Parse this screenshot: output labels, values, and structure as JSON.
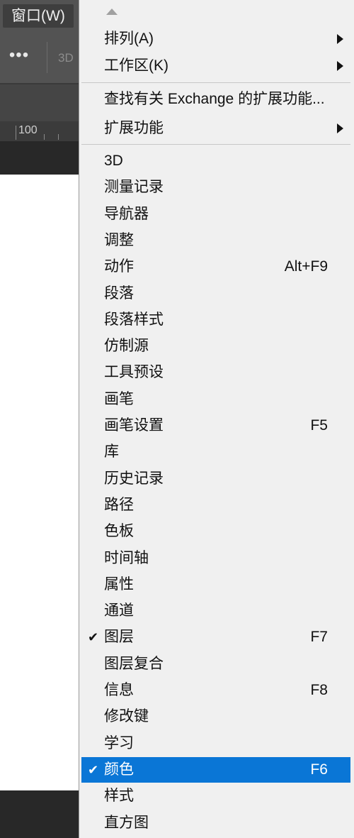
{
  "menubar": {
    "open_menu_label": "窗口(W)"
  },
  "options_bar": {
    "more_label": "•••",
    "mode_3d_label": "3D"
  },
  "ruler": {
    "label": "100"
  },
  "menu": {
    "submenu_items": [
      {
        "label": "排列(A)"
      },
      {
        "label": "工作区(K)"
      }
    ],
    "extension_items": [
      {
        "label": "查找有关 Exchange 的扩展功能..."
      },
      {
        "label": "扩展功能"
      }
    ],
    "panel_items": [
      {
        "label": "3D",
        "shortcut": ""
      },
      {
        "label": "测量记录",
        "shortcut": ""
      },
      {
        "label": "导航器",
        "shortcut": ""
      },
      {
        "label": "调整",
        "shortcut": ""
      },
      {
        "label": "动作",
        "shortcut": "Alt+F9"
      },
      {
        "label": "段落",
        "shortcut": ""
      },
      {
        "label": "段落样式",
        "shortcut": ""
      },
      {
        "label": "仿制源",
        "shortcut": ""
      },
      {
        "label": "工具预设",
        "shortcut": ""
      },
      {
        "label": "画笔",
        "shortcut": ""
      },
      {
        "label": "画笔设置",
        "shortcut": "F5"
      },
      {
        "label": "库",
        "shortcut": ""
      },
      {
        "label": "历史记录",
        "shortcut": ""
      },
      {
        "label": "路径",
        "shortcut": ""
      },
      {
        "label": "色板",
        "shortcut": ""
      },
      {
        "label": "时间轴",
        "shortcut": ""
      },
      {
        "label": "属性",
        "shortcut": ""
      },
      {
        "label": "通道",
        "shortcut": ""
      },
      {
        "label": "图层",
        "shortcut": "F7",
        "check": "✔"
      },
      {
        "label": "图层复合",
        "shortcut": ""
      },
      {
        "label": "信息",
        "shortcut": "F8"
      },
      {
        "label": "修改键",
        "shortcut": ""
      },
      {
        "label": "学习",
        "shortcut": ""
      },
      {
        "label": "颜色",
        "shortcut": "F6",
        "check": "✔",
        "selected": true
      },
      {
        "label": "样式",
        "shortcut": ""
      },
      {
        "label": "直方图",
        "shortcut": ""
      }
    ]
  },
  "colors": {
    "highlight": "#0a76d6",
    "menu_bg": "#f0f0f0",
    "app_bg": "#535353"
  }
}
